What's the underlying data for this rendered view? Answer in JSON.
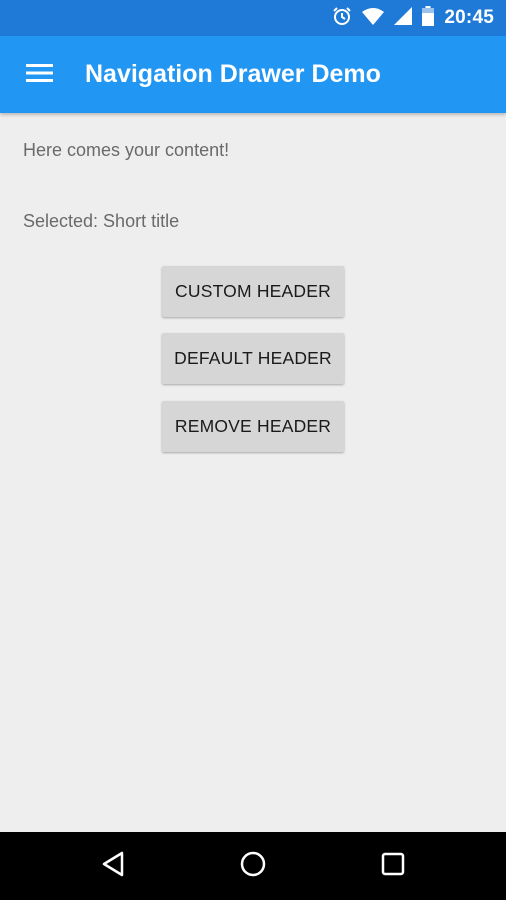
{
  "status_bar": {
    "time": "20:45",
    "icons": [
      "alarm-icon",
      "wifi-icon",
      "cell-signal-icon",
      "battery-icon"
    ]
  },
  "app_bar": {
    "menu_icon": "hamburger-menu-icon",
    "title": "Navigation Drawer Demo",
    "color": "#2196f3"
  },
  "content": {
    "message": "Here comes your content!",
    "selected": "Selected: Short title",
    "buttons": [
      {
        "label": "CUSTOM HEADER"
      },
      {
        "label": "DEFAULT HEADER"
      },
      {
        "label": "REMOVE HEADER"
      }
    ]
  },
  "nav_bar": {
    "icons": [
      "back-icon",
      "home-icon",
      "recents-icon"
    ]
  }
}
